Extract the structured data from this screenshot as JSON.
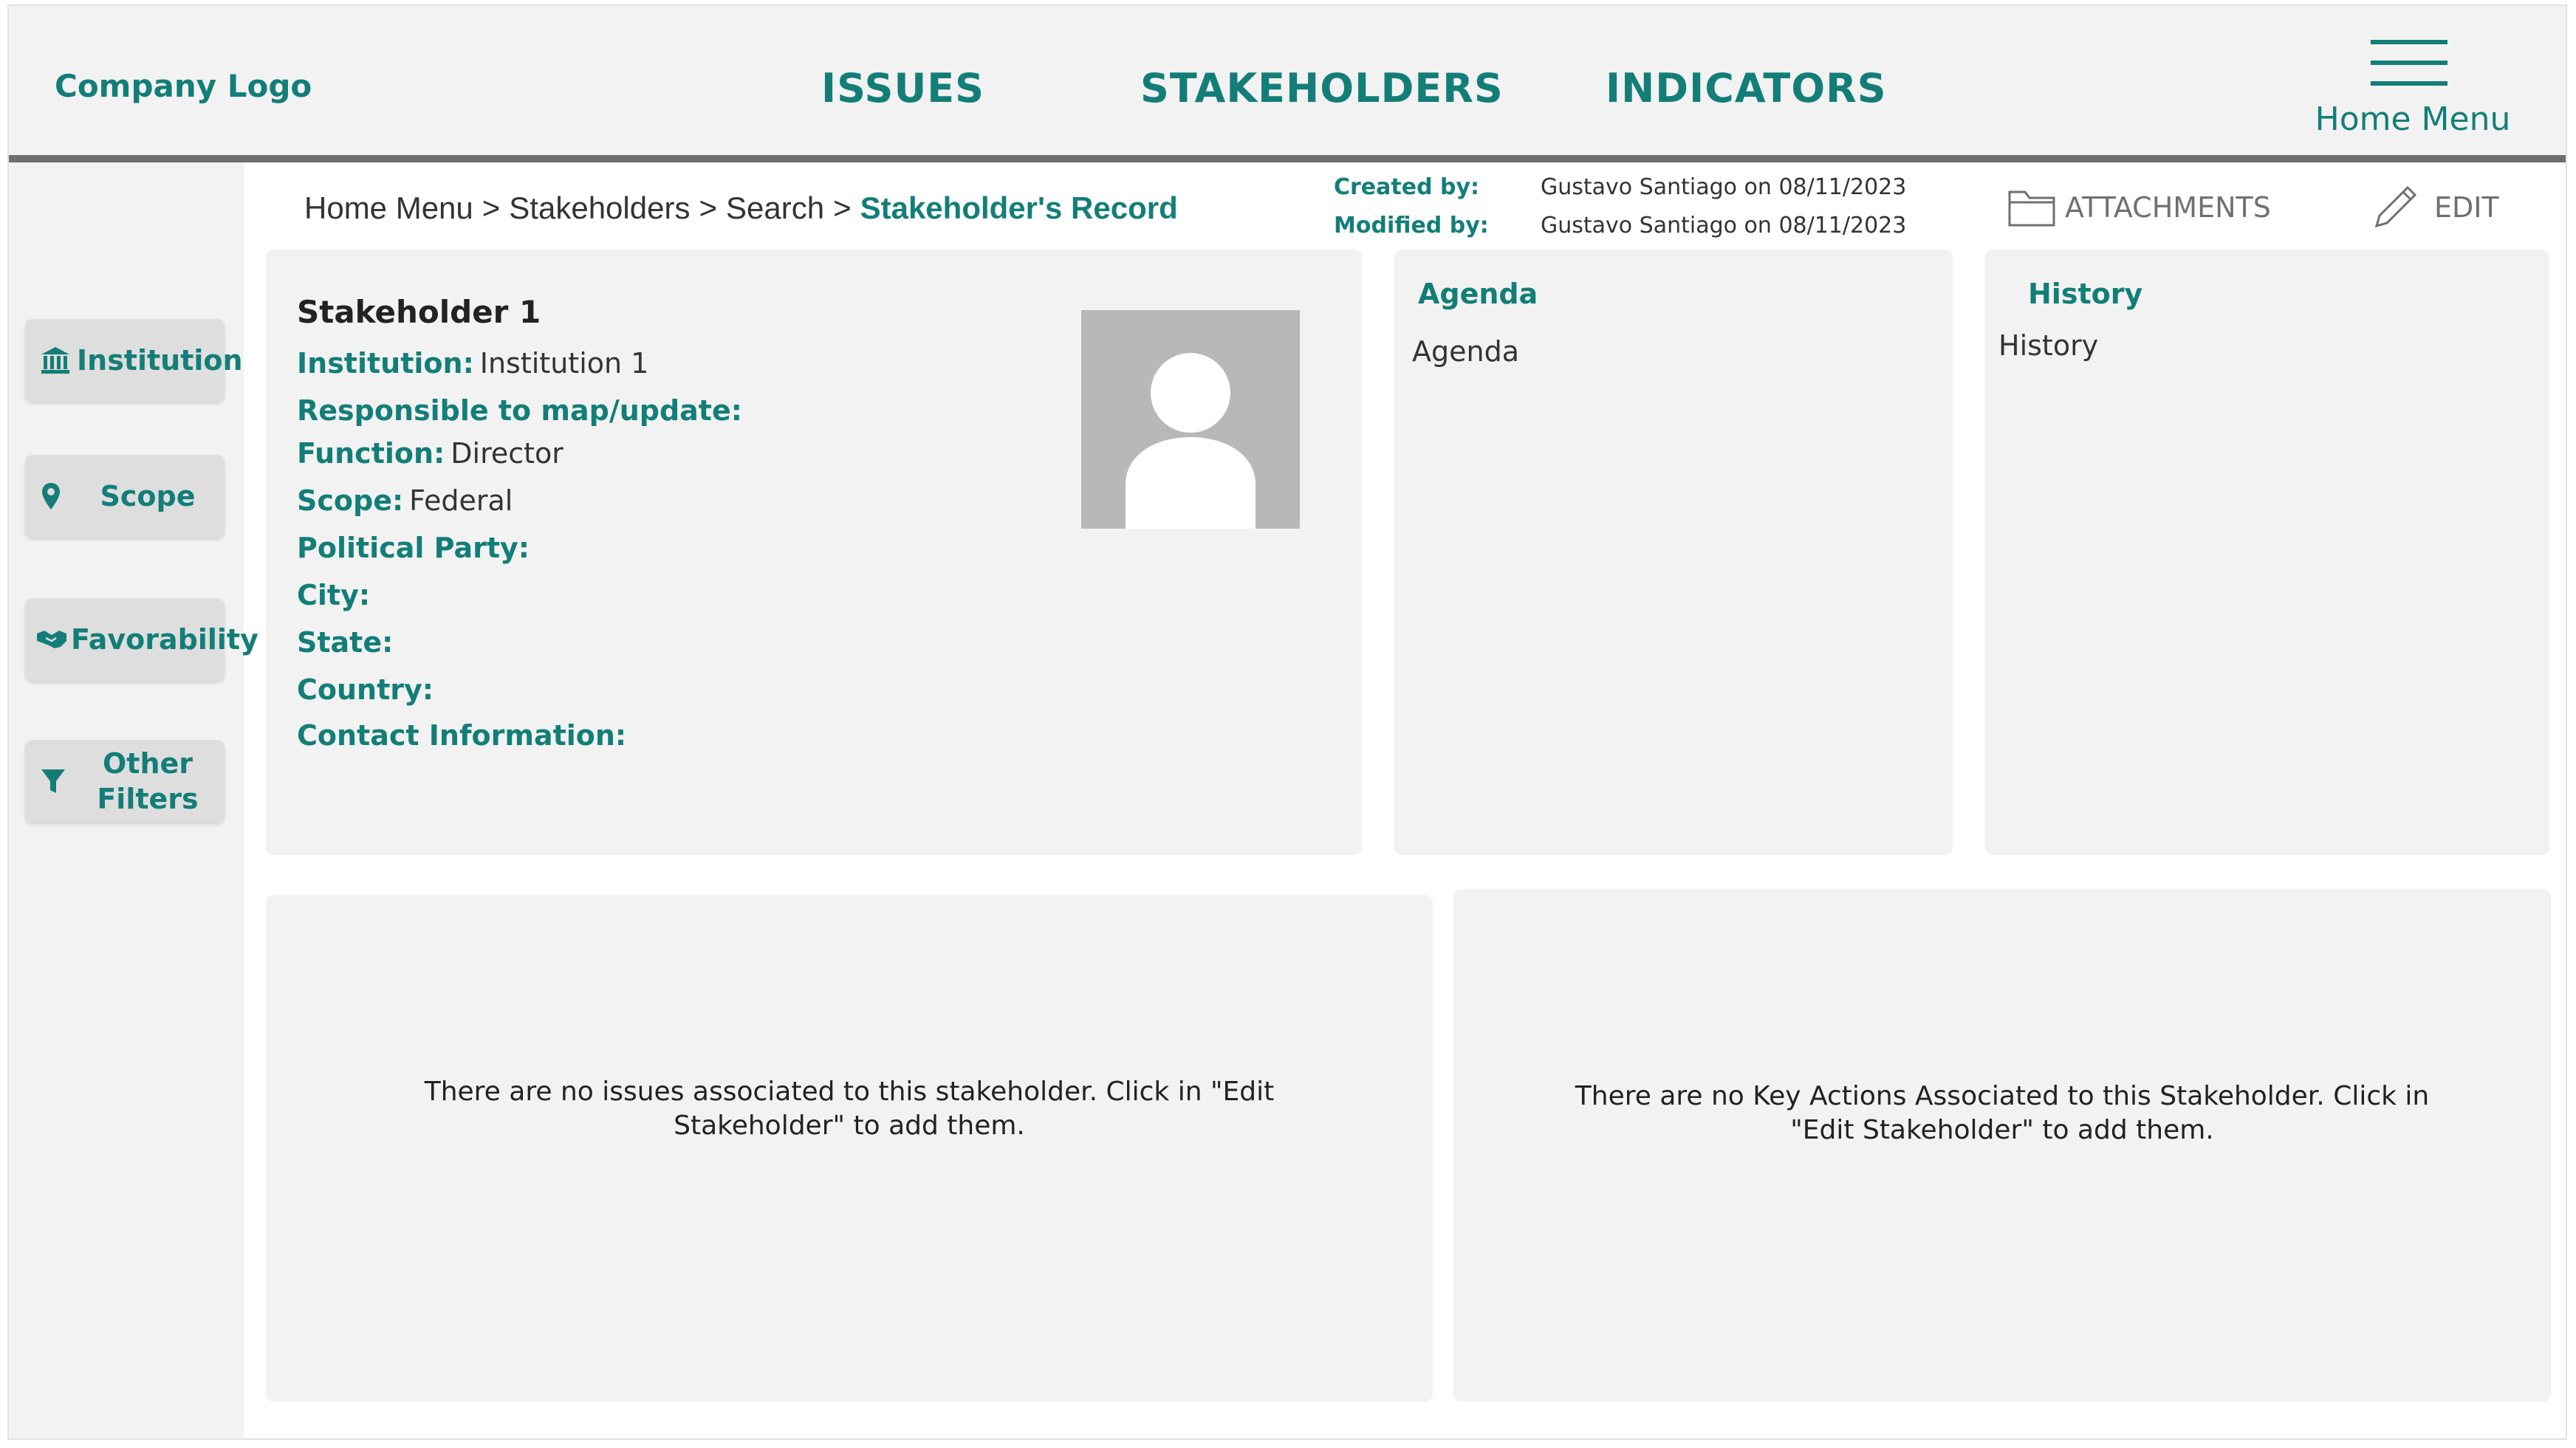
{
  "header": {
    "logo": "Company Logo",
    "nav": [
      "ISSUES",
      "STAKEHOLDERS",
      "INDICATORS"
    ],
    "home_menu_label": "Home Menu"
  },
  "sidebar": {
    "items": [
      {
        "label": "Institution",
        "icon": "institution-icon"
      },
      {
        "label": "Scope",
        "icon": "location-pin-icon"
      },
      {
        "label": "Favorability",
        "icon": "handshake-icon"
      },
      {
        "label": "Other Filters",
        "icon": "filter-icon"
      }
    ]
  },
  "breadcrumb": {
    "items": [
      "Home Menu",
      "Stakeholders",
      "Search"
    ],
    "current": "Stakeholder's Record",
    "separator": ">"
  },
  "meta": {
    "created_label": "Created by:",
    "created_value": "Gustavo Santiago on 08/11/2023",
    "modified_label": "Modified by:",
    "modified_value": "Gustavo Santiago on 08/11/2023"
  },
  "toolbar": {
    "attachments_label": "ATTACHMENTS",
    "edit_label": "EDIT"
  },
  "stakeholder": {
    "name": "Stakeholder 1",
    "fields": [
      {
        "label": "Institution:",
        "value": "Institution 1"
      },
      {
        "label": "Responsible to map/update:",
        "value": ""
      },
      {
        "label": "Function:",
        "value": "Director"
      },
      {
        "label": "Scope:",
        "value": "Federal"
      },
      {
        "label": "Political Party:",
        "value": ""
      },
      {
        "label": "City:",
        "value": ""
      },
      {
        "label": "State:",
        "value": ""
      },
      {
        "label": "Country:",
        "value": ""
      },
      {
        "label": "Contact Information:",
        "value": ""
      }
    ]
  },
  "agenda": {
    "title": "Agenda",
    "text": "Agenda"
  },
  "history": {
    "title": "History",
    "text": "History"
  },
  "issues_panel": {
    "empty_message": "There are no issues associated to this stakeholder. Click in \"Edit Stakeholder\" to add them."
  },
  "key_actions_panel": {
    "empty_message": "There are no Key Actions Associated to this Stakeholder. Click in \"Edit Stakeholder\" to add them."
  },
  "colors": {
    "accent": "#137e78",
    "panel_bg": "#f2f2f2",
    "button_bg": "#dedede",
    "avatar_bg": "#b8b8b8"
  }
}
